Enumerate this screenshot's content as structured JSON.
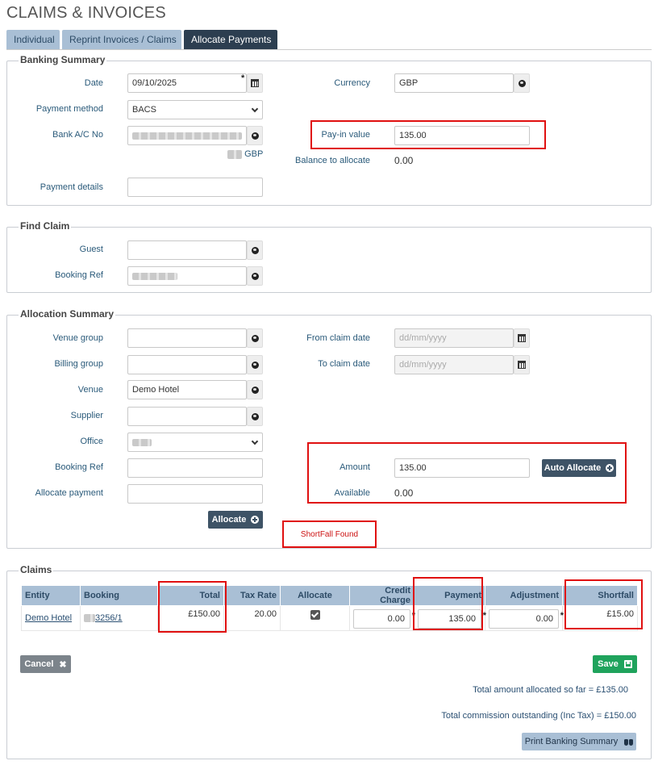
{
  "page_title": "CLAIMS & INVOICES",
  "tabs": [
    {
      "label": "Individual"
    },
    {
      "label": "Reprint Invoices / Claims"
    },
    {
      "label": "Allocate Payments"
    }
  ],
  "banking": {
    "legend": "Banking Summary",
    "date_label": "Date",
    "date_value": "09/10/2025",
    "payment_method_label": "Payment method",
    "payment_method_value": "BACS",
    "bank_ac_label": "Bank A/C No",
    "bank_currency": "GBP",
    "payment_details_label": "Payment details",
    "payment_details_value": "",
    "currency_label": "Currency",
    "currency_value": "GBP",
    "payin_label": "Pay-in value",
    "payin_value": "135.00",
    "balance_label": "Balance to allocate",
    "balance_value": "0.00"
  },
  "find_claim": {
    "legend": "Find Claim",
    "guest_label": "Guest",
    "guest_value": "",
    "booking_ref_label": "Booking Ref"
  },
  "allocation": {
    "legend": "Allocation Summary",
    "venue_group_label": "Venue group",
    "billing_group_label": "Billing group",
    "venue_label": "Venue",
    "venue_value": "Demo Hotel",
    "supplier_label": "Supplier",
    "office_label": "Office",
    "booking_ref_label": "Booking Ref",
    "allocate_payment_label": "Allocate payment",
    "allocate_button": "Allocate",
    "from_date_label": "From claim date",
    "from_date_placeholder": "dd/mm/yyyy",
    "to_date_label": "To claim date",
    "to_date_placeholder": "dd/mm/yyyy",
    "amount_label": "Amount",
    "amount_value": "135.00",
    "auto_allocate_button": "Auto Allocate",
    "available_label": "Available",
    "available_value": "0.00",
    "shortfall_message": "ShortFall Found"
  },
  "claims": {
    "legend": "Claims",
    "columns": [
      "Entity",
      "Booking",
      "Total",
      "Tax Rate",
      "Allocate",
      "Credit Charge",
      "Payment",
      "Adjustment",
      "Shortfall"
    ],
    "row": {
      "entity": "Demo Hotel",
      "booking": "3256/1",
      "total": "£150.00",
      "tax_rate": "20.00",
      "credit_charge": "0.00",
      "payment": "135.00",
      "adjustment": "0.00",
      "shortfall": "£15.00"
    },
    "cancel_button": "Cancel",
    "save_button": "Save",
    "total_allocated": "Total amount allocated so far = £135.00",
    "total_commission": "Total commission outstanding (Inc Tax) = £150.00",
    "print_button": "Print Banking Summary"
  },
  "colors": {
    "tab_active": "#2c3e50",
    "tab_inactive": "#a9bfd5",
    "highlight": "#e01010",
    "save_green": "#1fa35c"
  }
}
